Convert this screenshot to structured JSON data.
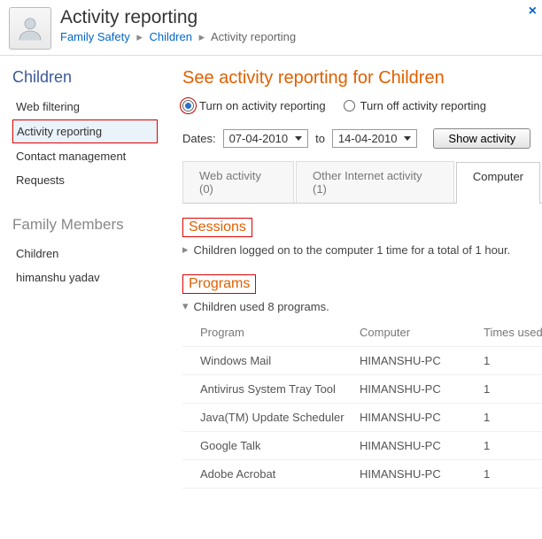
{
  "close_label": "×",
  "header": {
    "title": "Activity reporting",
    "breadcrumb": {
      "root": "Family Safety",
      "child": "Children",
      "current": "Activity reporting"
    }
  },
  "sidebar": {
    "children_heading": "Children",
    "items": [
      "Web filtering",
      "Activity reporting",
      "Contact management",
      "Requests"
    ],
    "selected_index": 1,
    "family_heading": "Family Members",
    "family": [
      "Children",
      "himanshu yadav"
    ]
  },
  "main": {
    "title": "See activity reporting for Children",
    "radio_on": "Turn on activity reporting",
    "radio_off": "Turn off activity reporting",
    "dates_label": "Dates:",
    "date_from": "07-04-2010",
    "date_to_label": "to",
    "date_to": "14-04-2010",
    "show_btn": "Show activity",
    "tabs": [
      "Web activity (0)",
      "Other Internet activity (1)",
      "Computer"
    ],
    "sessions_title": "Sessions",
    "sessions_text": "Children logged on to the computer 1 time for a total of 1 hour.",
    "programs_title": "Programs",
    "programs_summary": "Children used 8 programs.",
    "programs_cols": {
      "c1": "Program",
      "c2": "Computer",
      "c3": "Times used"
    },
    "programs_rows": [
      {
        "c1": "Windows Mail",
        "c2": "HIMANSHU-PC",
        "c3": "1"
      },
      {
        "c1": "Antivirus System Tray Tool",
        "c2": "HIMANSHU-PC",
        "c3": "1"
      },
      {
        "c1": "Java(TM) Update Scheduler",
        "c2": "HIMANSHU-PC",
        "c3": "1"
      },
      {
        "c1": "Google Talk",
        "c2": "HIMANSHU-PC",
        "c3": "1"
      },
      {
        "c1": "Adobe Acrobat",
        "c2": "HIMANSHU-PC",
        "c3": "1"
      }
    ]
  }
}
